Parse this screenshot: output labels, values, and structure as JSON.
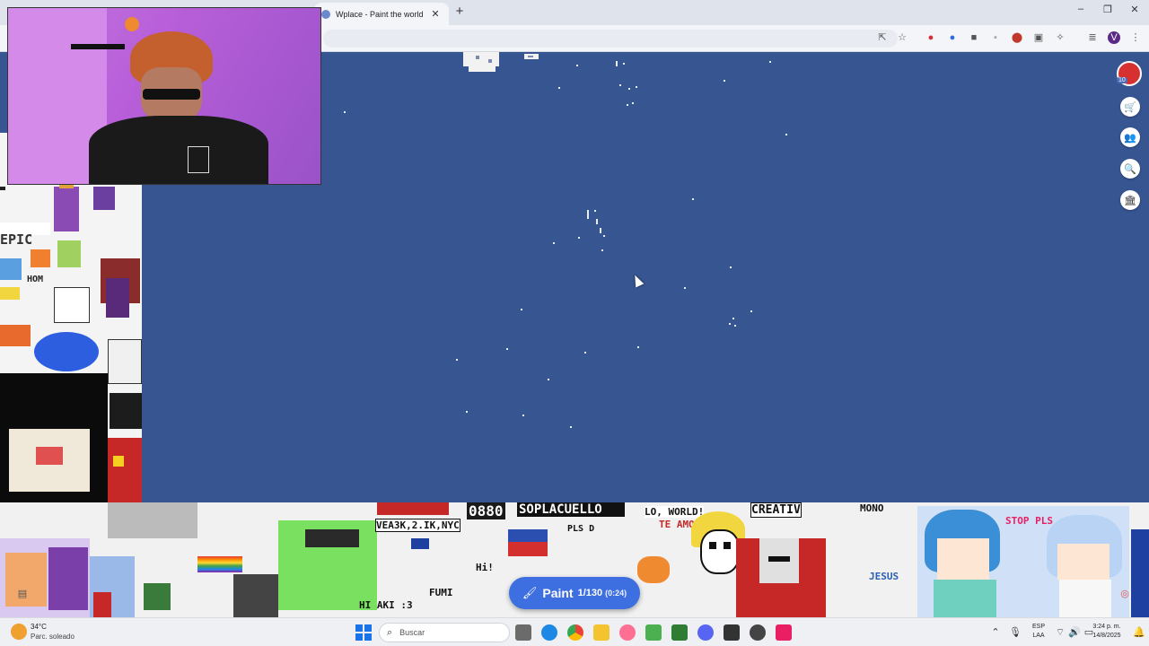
{
  "browser": {
    "tab_title": "Wplace - Paint the world",
    "tab_close": "✕",
    "new_tab": "+",
    "window_controls": {
      "minimize": "–",
      "maximize": "❐",
      "close": "✕"
    },
    "toolbar_icons": [
      "install-icon",
      "star-icon",
      "extension-icon",
      "puzzle-icon",
      "menu-icon"
    ]
  },
  "right_rail": {
    "notification_count": "10",
    "buttons": [
      "store-icon",
      "leaderboard-icon",
      "search-icon",
      "info-icon"
    ],
    "button_glyphs": {
      "store": "🛒",
      "leaderboard": "👥",
      "search": "🔍",
      "info": "🏛"
    }
  },
  "paint_button": {
    "icon": "🖌",
    "label": "Paint",
    "count": "1/130",
    "timer": "(0:24)"
  },
  "canvas": {
    "ocean_color": "#365591",
    "pixel_art_texts": [
      "EPIC",
      "HOM",
      "0880",
      "SOPLACUELLO",
      "LO, WORLD!",
      "CREATIV",
      "MONO",
      "STOP PLS",
      "VEA3K,2.IK,NYC",
      "PLS D",
      "TE AMO",
      "JESUS",
      "HI AKI :3",
      "FUMI",
      "Hi!"
    ]
  },
  "taskbar": {
    "weather_temp": "34°C",
    "weather_desc": "Parc. soleado",
    "search_placeholder": "Buscar",
    "lang_top": "ESP",
    "lang_bottom": "LAA",
    "time": "3:24 p. m.",
    "date": "14/8/2025"
  }
}
